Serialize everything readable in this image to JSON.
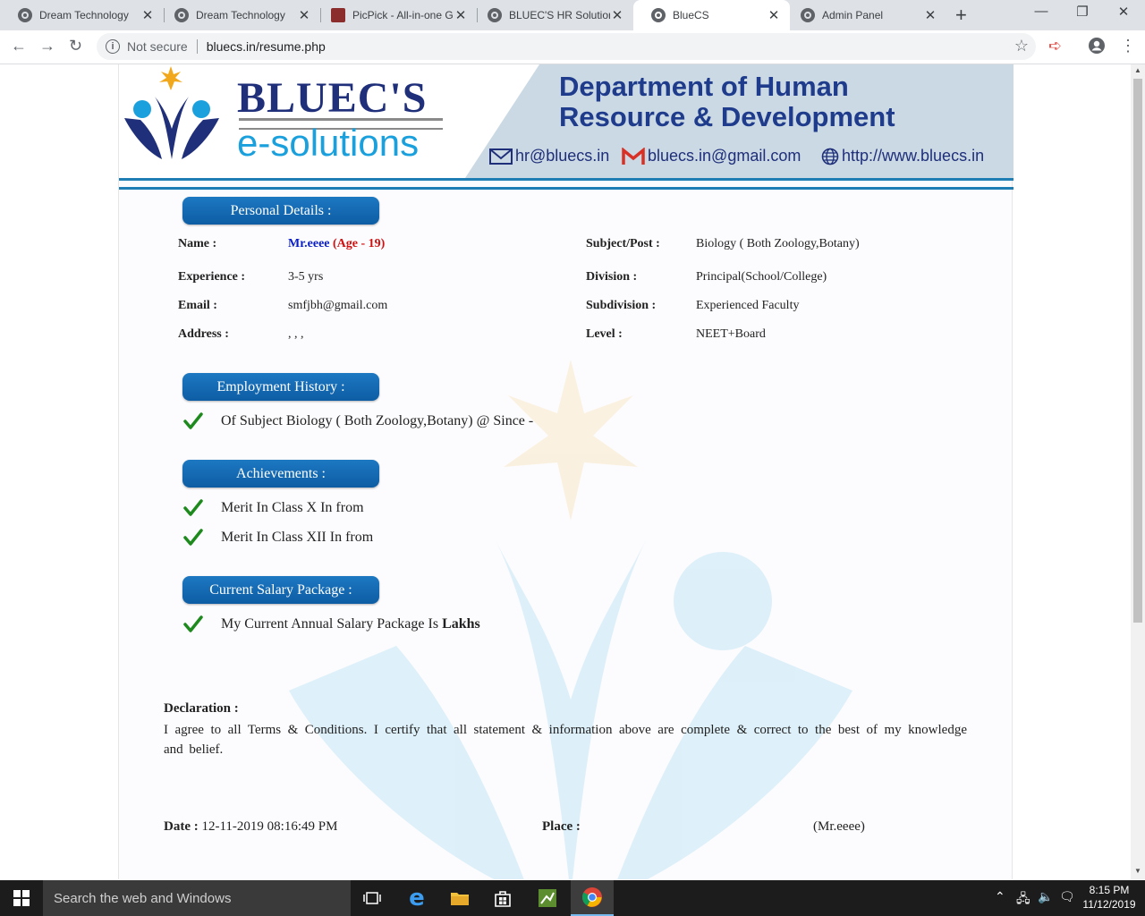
{
  "browser": {
    "tabs": [
      {
        "title": "Dream Technology",
        "icon": "globe-icon",
        "active": false
      },
      {
        "title": "Dream Technology",
        "icon": "globe-icon",
        "active": false
      },
      {
        "title": "PicPick - All-in-one G",
        "icon": "picpick-icon",
        "active": false
      },
      {
        "title": "BLUEC'S HR Solution",
        "icon": "globe-icon",
        "active": false
      },
      {
        "title": "BlueCS",
        "icon": "globe-icon",
        "active": true
      },
      {
        "title": "Admin Panel",
        "icon": "globe-icon",
        "active": false
      }
    ],
    "security_label": "Not secure",
    "url": "bluecs.in/resume.php"
  },
  "banner": {
    "logo_title": "BLUEC'S",
    "logo_subtitle": "e-solutions",
    "dept_line1": "Department of Human",
    "dept_line2": "Resource & Development",
    "email": "hr@bluecs.in",
    "gmail": "bluecs.in@gmail.com",
    "website": "http://www.bluecs.in"
  },
  "personal": {
    "heading": "Personal Details :",
    "name_label": "Name :",
    "name_value": "Mr.eeee",
    "age_value": "(Age - 19)",
    "experience_label": "Experience :",
    "experience_value": "3-5 yrs",
    "email_label": "Email :",
    "email_value": "smfjbh@gmail.com",
    "address_label": "Address :",
    "address_value": ", , ,",
    "subject_label": "Subject/Post :",
    "subject_value": "Biology ( Both Zoology,Botany)",
    "division_label": "Division :",
    "division_value": "Principal(School/College)",
    "subdivision_label": "Subdivision :",
    "subdivision_value": "Experienced Faculty",
    "level_label": "Level :",
    "level_value": "NEET+Board"
  },
  "employment": {
    "heading": "Employment History :",
    "items": [
      "Of Subject Biology ( Both Zoology,Botany) @ Since -"
    ]
  },
  "achievements": {
    "heading": "Achievements :",
    "items": [
      "Merit In Class X In from",
      "Merit In Class XII In from"
    ]
  },
  "salary": {
    "heading": "Current Salary Package :",
    "text": "My Current Annual Salary Package Is",
    "unit": "Lakhs"
  },
  "declaration": {
    "heading": "Declaration :",
    "text": "I agree to all Terms & Conditions. I certify that all statement & information above are complete & correct to the best of my knowledge and belief."
  },
  "footer": {
    "date_label": "Date :",
    "date_value": "12-11-2019 08:16:49 PM",
    "place_label": "Place :",
    "signature": "(Mr.eeee)"
  },
  "taskbar": {
    "search_placeholder": "Search the web and Windows",
    "time": "8:15 PM",
    "date": "11/12/2019"
  },
  "colors": {
    "accent_blue": "#0d5da4",
    "logo_navy": "#1f2f7a",
    "logo_cyan": "#1aa0dc",
    "check_green": "#1e8a1e",
    "age_red": "#d01010"
  }
}
